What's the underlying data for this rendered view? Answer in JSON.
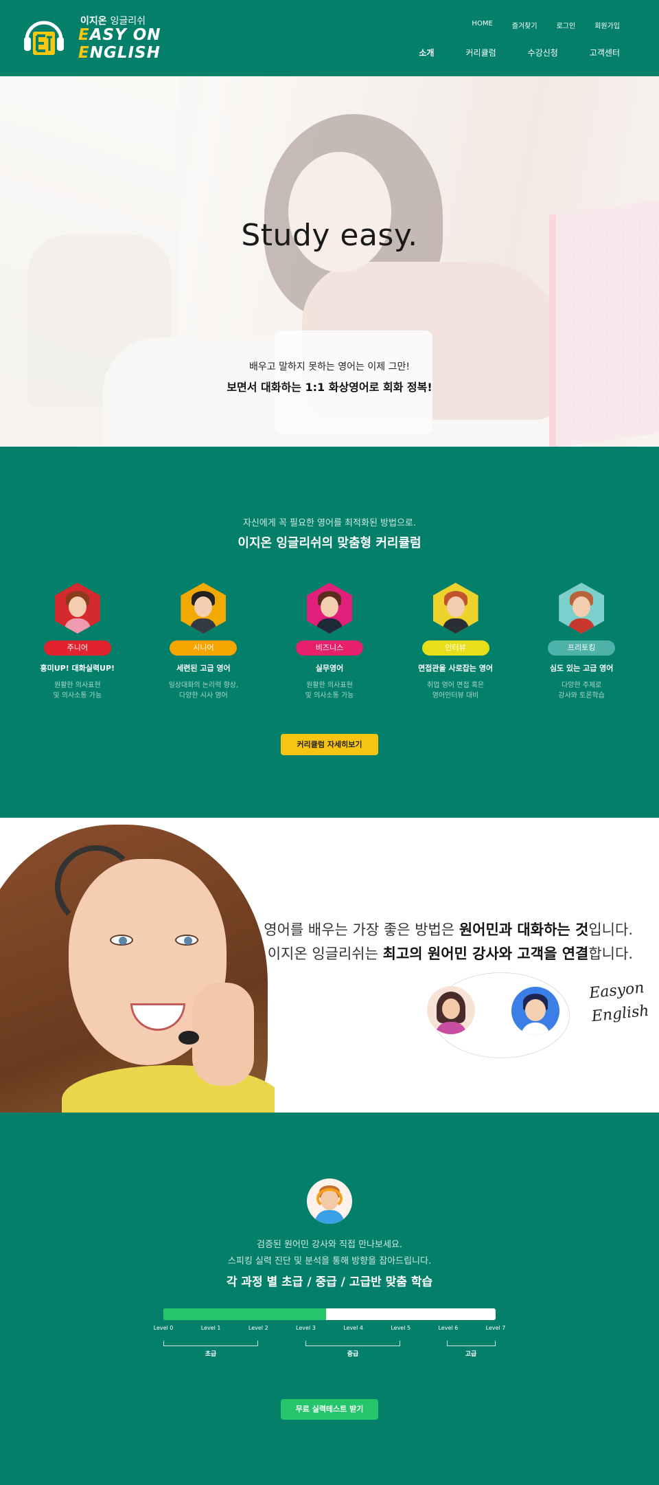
{
  "header": {
    "logo_kr_bold": "이지온",
    "logo_kr_thin": "잉글리쉬",
    "logo_en_line1": "EASY ON",
    "logo_en_line2": "ENGLISH",
    "top_nav": [
      "HOME",
      "즐겨찾기",
      "로그인",
      "회원가입"
    ],
    "main_nav": [
      "소개",
      "커리큘럼",
      "수강신청",
      "고객센터"
    ]
  },
  "hero": {
    "title": "Study easy.",
    "subtitle": "배우고 말하지 못하는 영어는 이제 그만!",
    "tagline": "보면서 대화하는 1:1 화상영어로 회화 정복!"
  },
  "curriculum": {
    "subtitle": "자신에게 꼭 필요한 영어를 최적화된 방법으로.",
    "title": "이지온 잉글리쉬의 맞춤형 커리큘럼",
    "cards": [
      {
        "badge": "주니어",
        "heading": "흥미UP! 대화실력UP!",
        "desc": "원활한 의사표현\n및 의사소통 가능",
        "color": "#e0232e",
        "hex": "#d42a2e",
        "hair": "#8b3b1c",
        "shirt": "#f09ab0"
      },
      {
        "badge": "시니어",
        "heading": "세련된 고급 영어",
        "desc": "일상대화의 논리력 향상,\n다양한 시사 영어",
        "color": "#f5a500",
        "hex": "#f2a900",
        "hair": "#222222",
        "shirt": "#333a44"
      },
      {
        "badge": "비즈니스",
        "heading": "실무영어",
        "desc": "원활한 의사표현\n및 의사소통 가능",
        "color": "#e7206c",
        "hex": "#e0207a",
        "hair": "#5a2a1a",
        "shirt": "#1f2a38"
      },
      {
        "badge": "인터뷰",
        "heading": "면접관을 사로잡는 영어",
        "desc": "취업 영어 면접 혹은\n영어인터뷰 대비",
        "color": "#e8df1a",
        "hex": "#ecd22a",
        "hair": "#c0542a",
        "shirt": "#2a2f36"
      },
      {
        "badge": "프리토킹",
        "heading": "심도 있는 고급 영어",
        "desc": "다양한 주제로\n강사와 토론학습",
        "color": "#4fb2a8",
        "hex": "#7ccfca",
        "hair": "#b8623a",
        "shirt": "#c8372e"
      }
    ],
    "button": "커리큘럼 자세히보기"
  },
  "native": {
    "line1_pre": "영어를 배우는 가장 좋은 방법은 ",
    "line1_bold": "원어민과 대화하는 것",
    "line1_post": "입니다.",
    "line2_pre": "이지온 잉글리쉬는 ",
    "line2_bold": "최고의 원어민 강사와 고객을 연결",
    "line2_post": "합니다.",
    "signature_line1": "Easyon",
    "signature_line2": "English"
  },
  "level": {
    "subtitle1": "검증된 원어민 강사와 직접 만나보세요.",
    "subtitle2": "스피킹 실력 진단 및 분석을 통해 방향을 잡아드립니다.",
    "title": "각 과정 별 초급 / 중급 / 고급반 맞춤 학습",
    "progress": 0.49,
    "levels": [
      "Level 0",
      "Level 1",
      "Level 2",
      "Level 3",
      "Level 4",
      "Level 5",
      "Level 6",
      "Level 7"
    ],
    "groups": [
      "초급",
      "중급",
      "고급"
    ],
    "button": "무료 실력테스트 받기"
  },
  "colors": {
    "brand_green": "#04806a",
    "accent_yellow": "#f8c414",
    "cta_green": "#25c56b"
  }
}
